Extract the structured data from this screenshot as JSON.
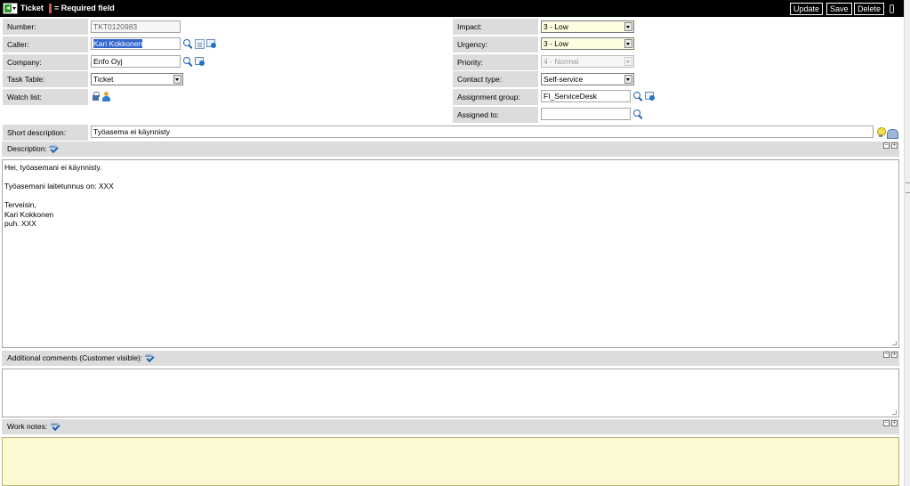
{
  "header": {
    "title": "Ticket",
    "required_legend": "= Required field",
    "buttons": {
      "update": "Update",
      "save": "Save",
      "delete": "Delete"
    }
  },
  "fields": {
    "number": {
      "label": "Number:",
      "value": "TKT0120983"
    },
    "caller": {
      "label": "Caller:",
      "value": "Kari Kokkonen"
    },
    "company": {
      "label": "Company:",
      "value": "Enfo Oyj"
    },
    "task_table": {
      "label": "Task Table:",
      "value": "Ticket"
    },
    "watch_list": {
      "label": "Watch list:"
    },
    "impact": {
      "label": "Impact:",
      "value": "3 - Low"
    },
    "urgency": {
      "label": "Urgency:",
      "value": "3 - Low"
    },
    "priority": {
      "label": "Priority:",
      "value": "4 - Normal"
    },
    "contact_type": {
      "label": "Contact type:",
      "value": "Self-service"
    },
    "assignment_group": {
      "label": "Assignment group:",
      "value": "FI_ServiceDesk"
    },
    "assigned_to": {
      "label": "Assigned to:",
      "value": ""
    },
    "short_description": {
      "label": "Short description:",
      "value": "Työasema ei käynnisty"
    }
  },
  "sections": {
    "description": {
      "label": "Description:",
      "value": "Hei, työasemani ei käynnisty.\n\nTyöasemani laitetunnus on: XXX\n\nTerveisin,\nKari Kokkonen\npuh. XXX"
    },
    "additional_comments": {
      "label": "Additional comments (Customer visible):",
      "value": ""
    },
    "work_notes": {
      "label": "Work notes:",
      "value": ""
    }
  },
  "colors": {
    "header_bg": "#000000",
    "label_bg": "#dcdcdc",
    "mandatory_marker": "#f0a030",
    "required_marker": "#d9534f",
    "changed_field_bg": "#fdfbe0",
    "work_notes_bg": "#fbf8d2",
    "selection": "#3366cc"
  }
}
